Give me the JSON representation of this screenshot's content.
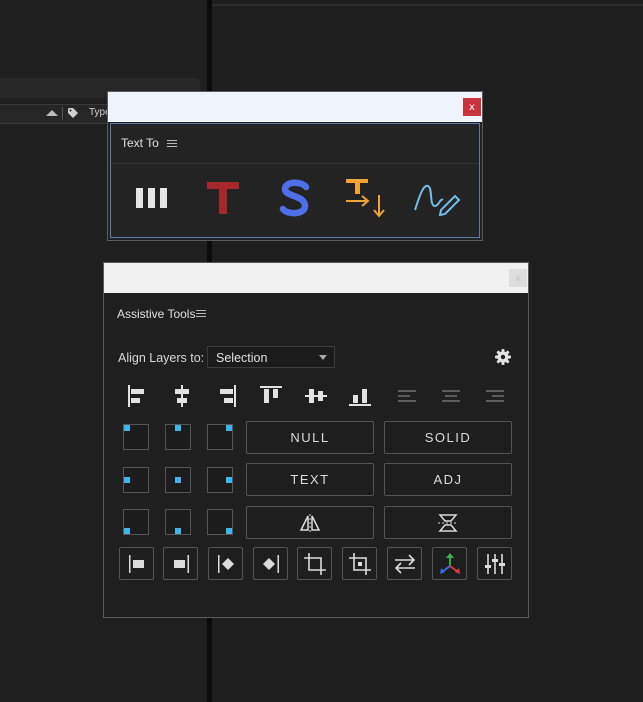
{
  "background": {
    "column_header": "Type"
  },
  "text_to_panel": {
    "close_label": "x",
    "title": "Text To",
    "tools": [
      {
        "icon": "bars-icon"
      },
      {
        "icon": "red-t-icon",
        "label": "T",
        "color": "#a6272c"
      },
      {
        "icon": "blue-s-icon",
        "label": "S",
        "color": "#4f6fe8"
      },
      {
        "icon": "text-to-arrows-icon",
        "label": "T",
        "color": "#f0a437"
      },
      {
        "icon": "pen-signature-icon",
        "color": "#6fbde8"
      }
    ]
  },
  "assistive_tools_panel": {
    "close_label": "x",
    "title": "Assistive Tools",
    "align_label": "Align Layers to:",
    "align_select_value": "Selection",
    "buttons": {
      "null": "NULL",
      "solid": "SOLID",
      "text": "TEXT",
      "adj": "ADJ"
    },
    "accent_color": "#3eb6ea"
  }
}
